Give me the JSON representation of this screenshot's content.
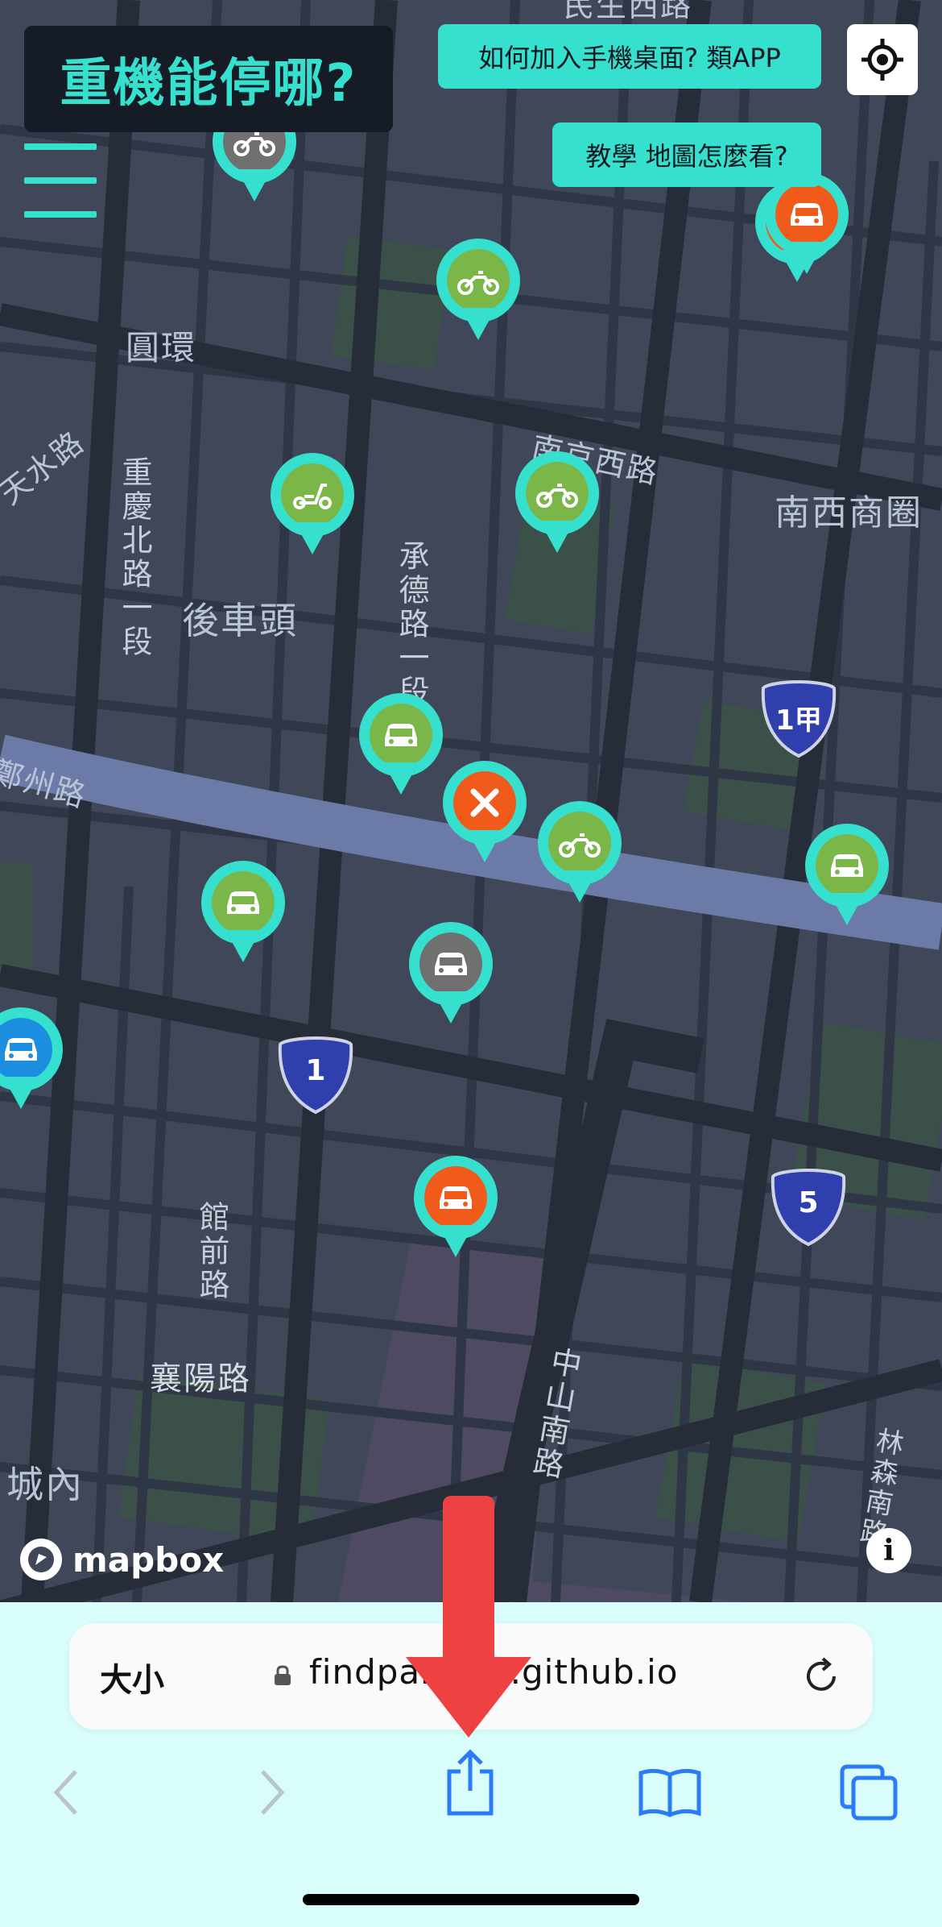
{
  "header": {
    "title": "重機能停哪?",
    "btn_add_home": "如何加入手機桌面? 類APP",
    "btn_tutorial": "教學 地圖怎麼看?"
  },
  "map": {
    "labels": {
      "yuanhuan": "圓環",
      "tianshui": "天水路",
      "nanjing": "南京西路",
      "nanxi": "南西商圈",
      "houchetou": "後車頭",
      "chongqing": "重慶北路一段",
      "chengde": "承德路一段",
      "zhengzhou": "鄭州路",
      "guanqian": "館前路",
      "xiangyang": "襄陽路",
      "chengnei": "城內",
      "zhongshan": "中山南路",
      "linsen": "林森南路",
      "minsheng": "民生西路"
    },
    "shields": [
      "1甲",
      "1",
      "5"
    ],
    "attribution": "mapbox",
    "colors": {
      "teal": "#36e0cf",
      "green": "#7ab648",
      "orange": "#f05a1a",
      "gray": "#707070",
      "blue": "#1c8ee0"
    }
  },
  "browser": {
    "text_size": "大小",
    "url": "findparking.github.io",
    "nav": [
      "back-icon",
      "forward-icon",
      "share-icon",
      "bookmarks-icon",
      "tabs-icon"
    ]
  }
}
